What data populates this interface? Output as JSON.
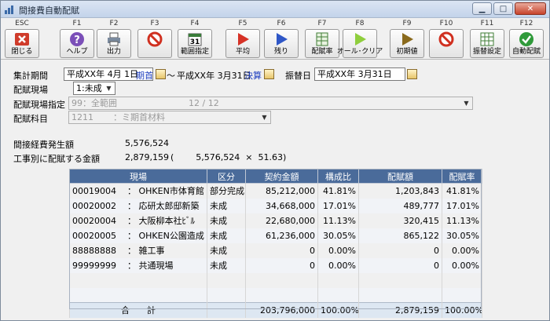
{
  "window": {
    "title": "間接費自動配賦",
    "minimize": "▁",
    "maximize": "□",
    "close": "✕"
  },
  "toolbar": [
    {
      "key": "ESC",
      "label": "閉じる",
      "icon": "close-icon"
    },
    {
      "key": "F1",
      "label": "ヘルプ",
      "icon": "help-icon"
    },
    {
      "key": "F2",
      "label": "出力",
      "icon": "printer-icon"
    },
    {
      "key": "F3",
      "label": "",
      "icon": "no-entry-icon"
    },
    {
      "key": "F4",
      "label": "範囲指定",
      "icon": "calendar-icon"
    },
    {
      "key": "F5",
      "label": "平均",
      "icon": "play-red-icon"
    },
    {
      "key": "F6",
      "label": "残り",
      "icon": "play-blue-icon"
    },
    {
      "key": "F7",
      "label": "配賦率",
      "icon": "sheet-icon"
    },
    {
      "key": "F8",
      "label": "オール･クリア",
      "icon": "play-green-icon"
    },
    {
      "key": "F9",
      "label": "初期値",
      "icon": "play-brown-icon"
    },
    {
      "key": "F10",
      "label": "",
      "icon": "no-entry-icon"
    },
    {
      "key": "F11",
      "label": "振替設定",
      "icon": "grid-icon"
    },
    {
      "key": "F12",
      "label": "自動配賦",
      "icon": "check-icon"
    }
  ],
  "form": {
    "period_label": "集計期間",
    "period_from": "平成XX年 4月 1日",
    "period_start_tag": "期首",
    "tilde": "～",
    "period_to": "平成XX年 3月31日",
    "period_end_tag": "決算",
    "transfer_date_label": "振替日",
    "transfer_date": "平成XX年 3月31日",
    "site_label": "配賦現場",
    "site_value": "1:未成",
    "site_range_label": "配賦現場指定",
    "site_range_value": "99：全範囲",
    "site_range_count": "12 / 12",
    "account_label": "配賦科目",
    "account_code": "1211",
    "account_name": "：ミ期首材料"
  },
  "summary": {
    "overhead_label": "間接経費発生額",
    "overhead_value": "5,576,524",
    "per_job_label": "工事別に配賦する金額",
    "per_job_value": "2,879,159",
    "formula": "(        5,576,524  ×  51.63)"
  },
  "grid": {
    "headers": [
      "現場",
      "区分",
      "契約金額",
      "構成比",
      "配賦額",
      "配賦率"
    ],
    "rows": [
      [
        "00019004",
        "： OHKEN市体育館",
        "部分完成",
        "85,212,000",
        "41.81%",
        "1,203,843",
        "41.81%"
      ],
      [
        "00020002",
        "： 応研太郎邸新築",
        "未成",
        "34,668,000",
        "17.01%",
        "489,777",
        "17.01%"
      ],
      [
        "00020004",
        "： 大阪柳本社ﾋﾞﾙ",
        "未成",
        "22,680,000",
        "11.13%",
        "320,415",
        "11.13%"
      ],
      [
        "00020005",
        "： OHKEN公園造成",
        "未成",
        "61,236,000",
        "30.05%",
        "865,122",
        "30.05%"
      ],
      [
        "88888888",
        "： 雑工事",
        "未成",
        "0",
        "0.00%",
        "0",
        "0.00%"
      ],
      [
        "99999999",
        "： 共通現場",
        "未成",
        "0",
        "0.00%",
        "0",
        "0.00%"
      ],
      [
        "",
        "",
        "",
        "",
        "",
        "",
        ""
      ],
      [
        "",
        "",
        "",
        "",
        "",
        "",
        ""
      ]
    ],
    "total": {
      "label": "合　　計",
      "amount": "203,796,000",
      "ratio": "100.00%",
      "alloc": "2,879,159",
      "rate": "100.00%"
    }
  },
  "colors": {
    "header": "#4a6b9a",
    "accent": "#1f3fbf",
    "total_row": "#dde7f2"
  }
}
